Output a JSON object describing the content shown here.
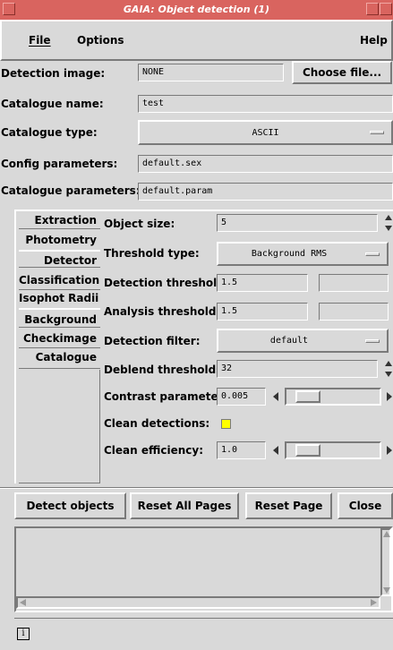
{
  "window": {
    "title": "GAIA: Object detection (1)"
  },
  "menubar": {
    "file": "File",
    "options": "Options",
    "help": "Help"
  },
  "top": {
    "detection_image": {
      "label": "Detection image:",
      "value": "NONE",
      "button": "Choose file..."
    },
    "catalogue_name": {
      "label": "Catalogue name:",
      "value": "test"
    },
    "catalogue_type": {
      "label": "Catalogue type:",
      "value": "ASCII"
    },
    "config_parameters": {
      "label": "Config parameters:",
      "value": "default.sex"
    },
    "catalogue_parameters": {
      "label": "Catalogue parameters:",
      "value": "default.param"
    }
  },
  "tabs": [
    {
      "label": "Extraction"
    },
    {
      "label": "Photometry"
    },
    {
      "label": "Detector"
    },
    {
      "label": "Classification"
    },
    {
      "label": "Isophot Radii"
    },
    {
      "label": "Background"
    },
    {
      "label": "Checkimage"
    },
    {
      "label": "Catalogue"
    }
  ],
  "extraction": {
    "object_size": {
      "label": "Object size:",
      "value": "5"
    },
    "threshold_type": {
      "label": "Threshold type:",
      "value": "Background RMS"
    },
    "detection_threshold": {
      "label": "Detection threshold:",
      "value": "1.5",
      "value2": ""
    },
    "analysis_threshold": {
      "label": "Analysis threshold:",
      "value": "1.5",
      "value2": ""
    },
    "detection_filter": {
      "label": "Detection filter:",
      "value": "default"
    },
    "deblend_thresholds": {
      "label": "Deblend thresholds:",
      "value": "32"
    },
    "contrast_parameter": {
      "label": "Contrast parameter:",
      "value": "0.005"
    },
    "clean_detections": {
      "label": "Clean detections:",
      "checked": true,
      "indicator_color": "#ffff00"
    },
    "clean_efficiency": {
      "label": "Clean efficiency:",
      "value": "1.0"
    }
  },
  "actions": {
    "detect": "Detect objects",
    "reset_all": "Reset All Pages",
    "reset_page": "Reset Page",
    "close": "Close"
  },
  "status": {
    "info_icon_text": "i"
  }
}
